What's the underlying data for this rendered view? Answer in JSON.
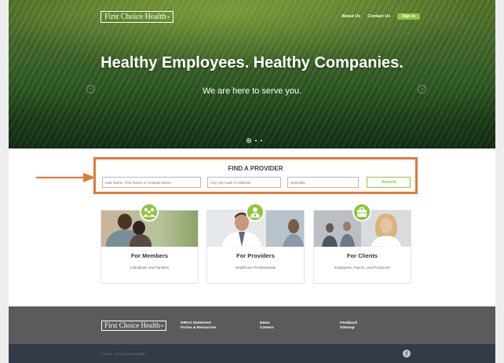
{
  "header": {
    "logo_text": "First Choice Health",
    "logo_mark": "™",
    "nav": {
      "about": "About Us",
      "contact": "Contact Us",
      "signin": "Sign In"
    }
  },
  "hero": {
    "title": "Healthy Employees. Healthy Companies.",
    "subtitle": "We are here to serve you.",
    "slide_count": 3,
    "active_slide": 1
  },
  "finder": {
    "title": "FIND A PROVIDER",
    "name_placeholder": "Last Name, First Name or Hospital Name",
    "location_placeholder": "City, Zip-code or Address",
    "specialty_placeholder": "Specialty",
    "search_label": "Search"
  },
  "cards": [
    {
      "title": "For Members",
      "desc": "Individuals and Families",
      "icon": "family-icon"
    },
    {
      "title": "For Providers",
      "desc": "Healthcare Professionals",
      "icon": "doctor-icon"
    },
    {
      "title": "For Clients",
      "desc": "Employers, Payors, and Producers",
      "icon": "briefcase-icon"
    }
  ],
  "footer": {
    "logo_text": "First Choice Health",
    "logo_mark": "™",
    "col1": [
      "HIPAA Statement",
      "Forms & Resources"
    ],
    "col2": [
      "News",
      "Careers"
    ],
    "col3": [
      "Feedback",
      "Sitemap"
    ],
    "copyright": "© 2018 - First Choice Health",
    "social_icon": "facebook-icon"
  },
  "colors": {
    "accent_green": "#8dc63f",
    "highlight_orange": "#e07b38",
    "footer_gray": "#5b5b5d",
    "bottom_navy": "#343b48"
  }
}
